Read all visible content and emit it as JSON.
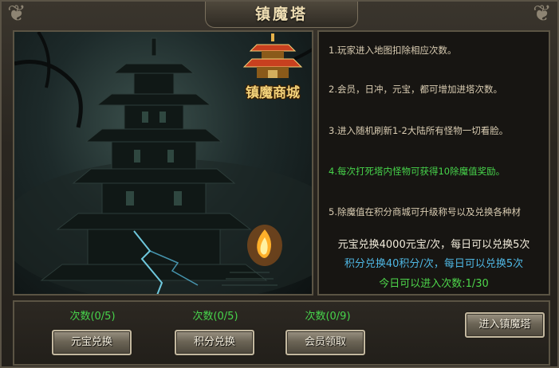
{
  "window": {
    "title": "镇魔塔"
  },
  "shop_badge": {
    "label": "镇魔商城",
    "icon": "pagoda-icon"
  },
  "rules": [
    "1.玩家进入地图扣除相应次数。",
    "2.会员，日冲，元宝，都可增加进塔次数。",
    "3.进入随机刷新1-2大陆所有怪物一切看脸。",
    "4.每次打死塔内怪物可获得10除魔值奖励。",
    "5.除魔值在积分商城可升级称号以及兑换各种材"
  ],
  "summary": {
    "yuanbao_line": "元宝兑换4000元宝/次，每日可以兑换5次",
    "points_line": "积分兑换40积分/次，每日可以兑换5次",
    "today_line": "今日可以进入次数:1/30"
  },
  "actions": {
    "yuanbao": {
      "count": "次数(0/5)",
      "label": "元宝兑换"
    },
    "points": {
      "count": "次数(0/5)",
      "label": "积分兑换"
    },
    "vip": {
      "count": "次数(0/9)",
      "label": "会员领取"
    },
    "enter": {
      "label": "进入镇魔塔"
    }
  },
  "colors": {
    "green": "#47d44b",
    "blue": "#4fb7e3",
    "gold": "#f3d27a",
    "text": "#d9ccb2"
  }
}
